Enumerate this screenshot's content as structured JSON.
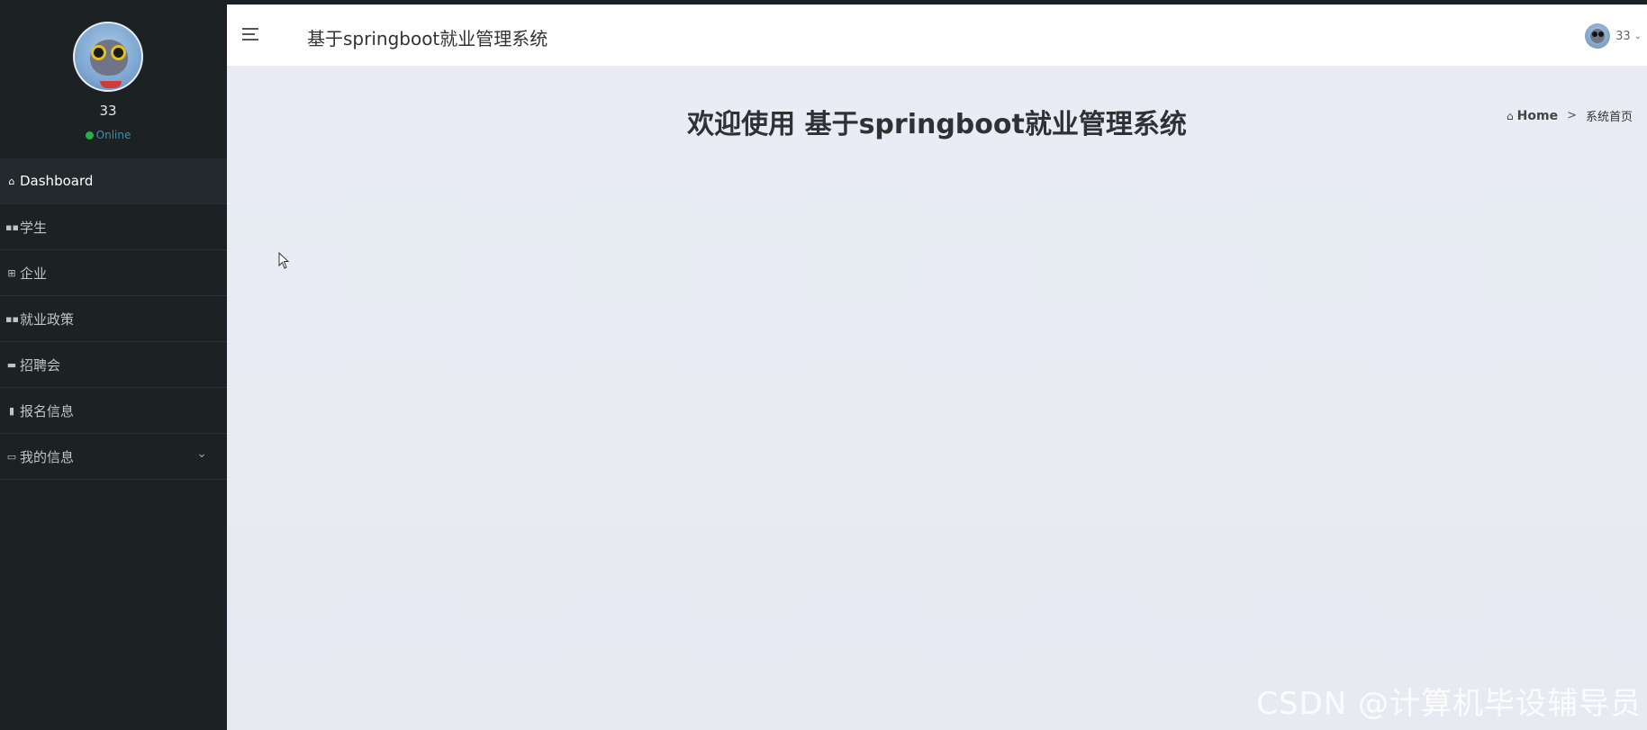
{
  "sidebar": {
    "user": {
      "name": "33",
      "status": "Online"
    },
    "items": [
      {
        "label": "Dashboard",
        "icon": "home-icon",
        "active": true
      },
      {
        "label": "学生",
        "icon": "grid-icon"
      },
      {
        "label": "企业",
        "icon": "grid-small-icon"
      },
      {
        "label": "就业政策",
        "icon": "grid-icon"
      },
      {
        "label": "招聘会",
        "icon": "comment-icon"
      },
      {
        "label": "报名信息",
        "icon": "bar-chart-icon"
      },
      {
        "label": "我的信息",
        "icon": "card-icon",
        "expandable": true
      }
    ]
  },
  "header": {
    "title": "基于springboot就业管理系统",
    "user_name": "33"
  },
  "main": {
    "welcome": "欢迎使用 基于springboot就业管理系统",
    "breadcrumb": {
      "home": "Home",
      "separator": ">",
      "current": "系统首页"
    }
  },
  "watermark": "CSDN @计算机毕设辅导员",
  "colors": {
    "sidebar_bg": "#1c2124",
    "online": "#21b24b",
    "link": "#3c8dbc",
    "content_bg": "#e8ebf2"
  }
}
